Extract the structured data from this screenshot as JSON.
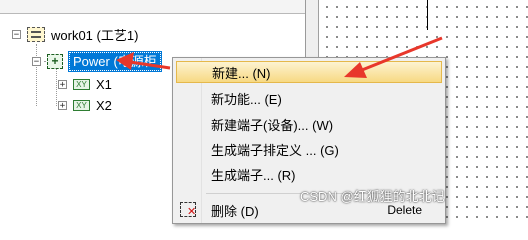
{
  "tree": {
    "nodes": [
      {
        "label": "work01 (工艺1)",
        "expander": "−",
        "icon": "project-icon"
      },
      {
        "label": "Power (电源柜",
        "expander": "−",
        "icon": "power-icon",
        "icon_glyph": "+"
      },
      {
        "label": "X1",
        "expander": "+",
        "icon": "terminal-strip-icon",
        "icon_glyph": "XY"
      },
      {
        "label": "X2",
        "expander": "+",
        "icon": "terminal-strip-icon",
        "icon_glyph": "XY"
      }
    ]
  },
  "context_menu": {
    "items": [
      {
        "label": "新建...",
        "shortcut": "(N)"
      },
      {
        "label": "新功能...",
        "shortcut": "(E)"
      },
      {
        "label": "新建端子(设备)...",
        "shortcut": "(W)"
      },
      {
        "label": "生成端子排定义 ...",
        "shortcut": "(G)"
      },
      {
        "label": "生成端子...",
        "shortcut": "(R)"
      },
      {
        "label": "删除",
        "shortcut": "(D)",
        "accelerator": "Delete",
        "icon": "delete-icon"
      }
    ],
    "highlight_color": "#f7d983"
  },
  "annotations": {
    "arrow_color": "#e8372b"
  },
  "watermark": {
    "text": "CSDN @红狐狸的北北记"
  }
}
